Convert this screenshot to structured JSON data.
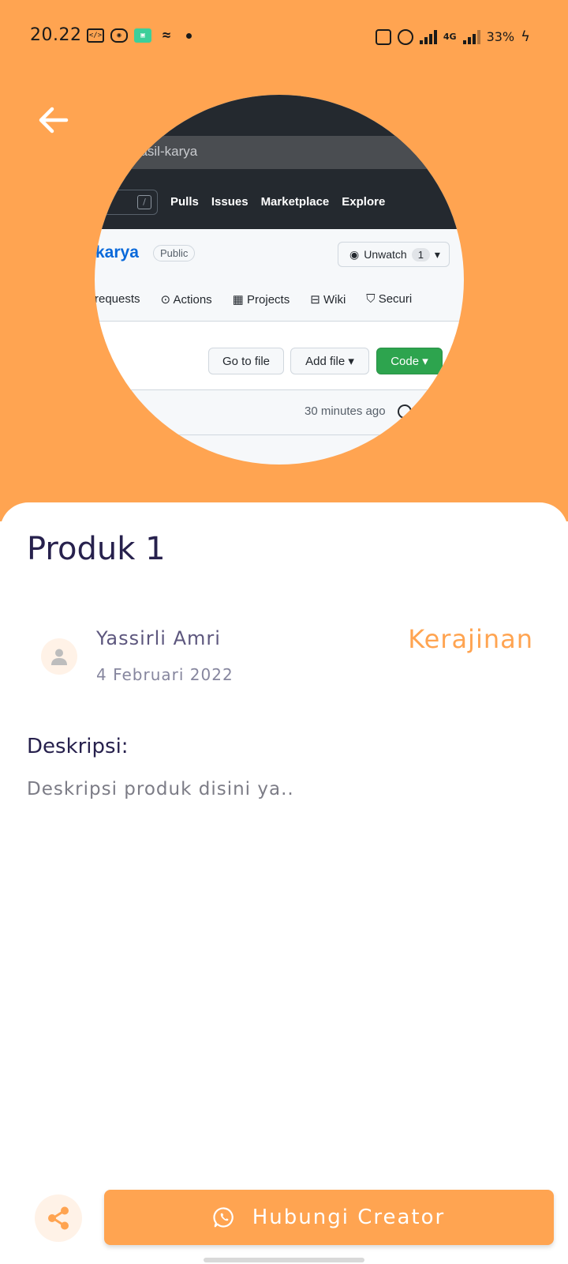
{
  "status_bar": {
    "time": "20.22",
    "network": "4G",
    "battery": "33%"
  },
  "product": {
    "title": "Produk 1",
    "creator_name": "Yassirli Amri",
    "date": "4 Februari 2022",
    "category": "Kerajinan",
    "description_label": "Deskripsi:",
    "description": "Deskripsi produk disini ya..",
    "image": {
      "url_text": "hasil-karya",
      "search_key": "/",
      "nav": [
        "Pulls",
        "Issues",
        "Marketplace",
        "Explore"
      ],
      "repo_title": "-karya",
      "visibility": "Public",
      "unwatch_label": "Unwatch",
      "watch_count": "1",
      "tabs": [
        "requests",
        "Actions",
        "Projects",
        "Wiki",
        "Securi"
      ],
      "btn_go_to_file": "Go to file",
      "btn_add_file": "Add file ▾",
      "btn_code": "Code ▾",
      "updated": "30 minutes ago"
    }
  },
  "actions": {
    "contact_label": "Hubungi Creator"
  },
  "colors": {
    "accent": "#FFA451",
    "title": "#27214D",
    "avatar_bg": "#FFF2E7"
  }
}
